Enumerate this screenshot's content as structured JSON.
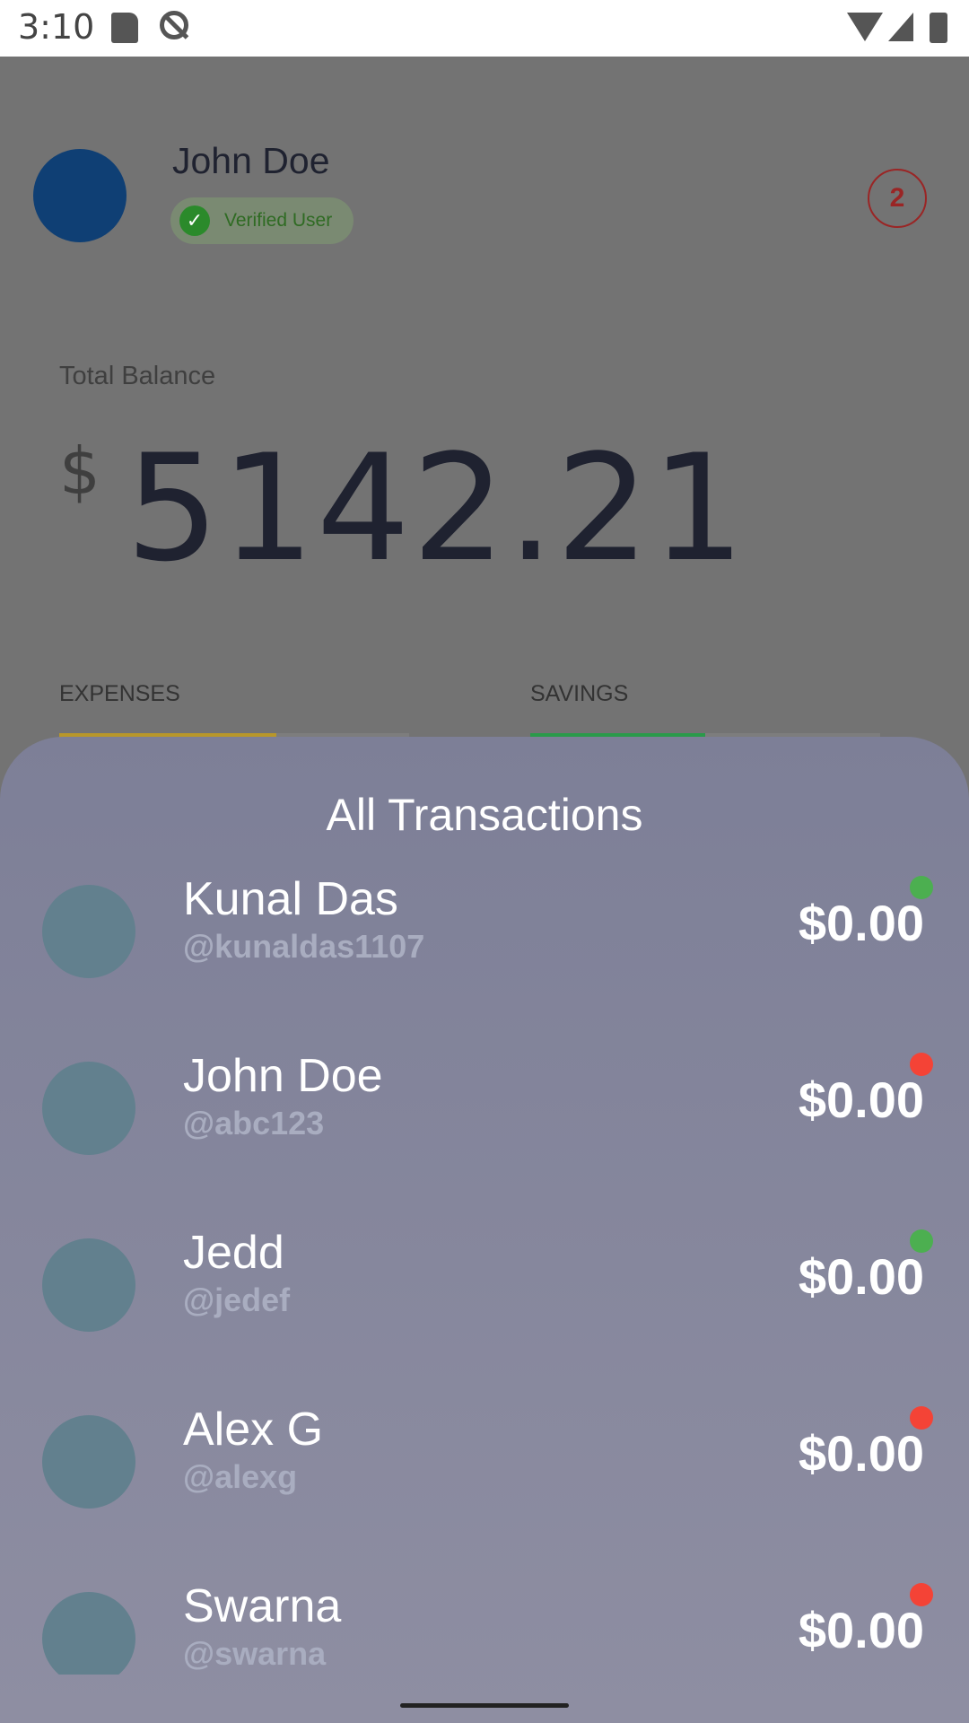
{
  "status_bar": {
    "time": "3:10"
  },
  "profile": {
    "name": "John Doe",
    "verified_label": "Verified User",
    "notification_count": "2"
  },
  "balance": {
    "label": "Total Balance",
    "currency": "$",
    "value": "5142.21"
  },
  "stats": {
    "expenses_label": "EXPENSES",
    "savings_label": "SAVINGS",
    "expenses_progress": 0.62,
    "savings_progress": 0.5
  },
  "colors": {
    "expenses_bar": "#b8972a",
    "savings_bar": "#2a9a4a",
    "positive_dot": "#4caf50",
    "negative_dot": "#f44336"
  },
  "sheet": {
    "title": "All Transactions"
  },
  "transactions": [
    {
      "name": "Kunal Das",
      "handle": "@kunaldas1107",
      "amount": "$0.00",
      "status": "positive"
    },
    {
      "name": "John Doe",
      "handle": "@abc123",
      "amount": "$0.00",
      "status": "negative"
    },
    {
      "name": "Jedd",
      "handle": "@jedef",
      "amount": "$0.00",
      "status": "positive"
    },
    {
      "name": "Alex G",
      "handle": "@alexg",
      "amount": "$0.00",
      "status": "negative"
    },
    {
      "name": "Swarna",
      "handle": "@swarna",
      "amount": "$0.00",
      "status": "negative"
    }
  ]
}
